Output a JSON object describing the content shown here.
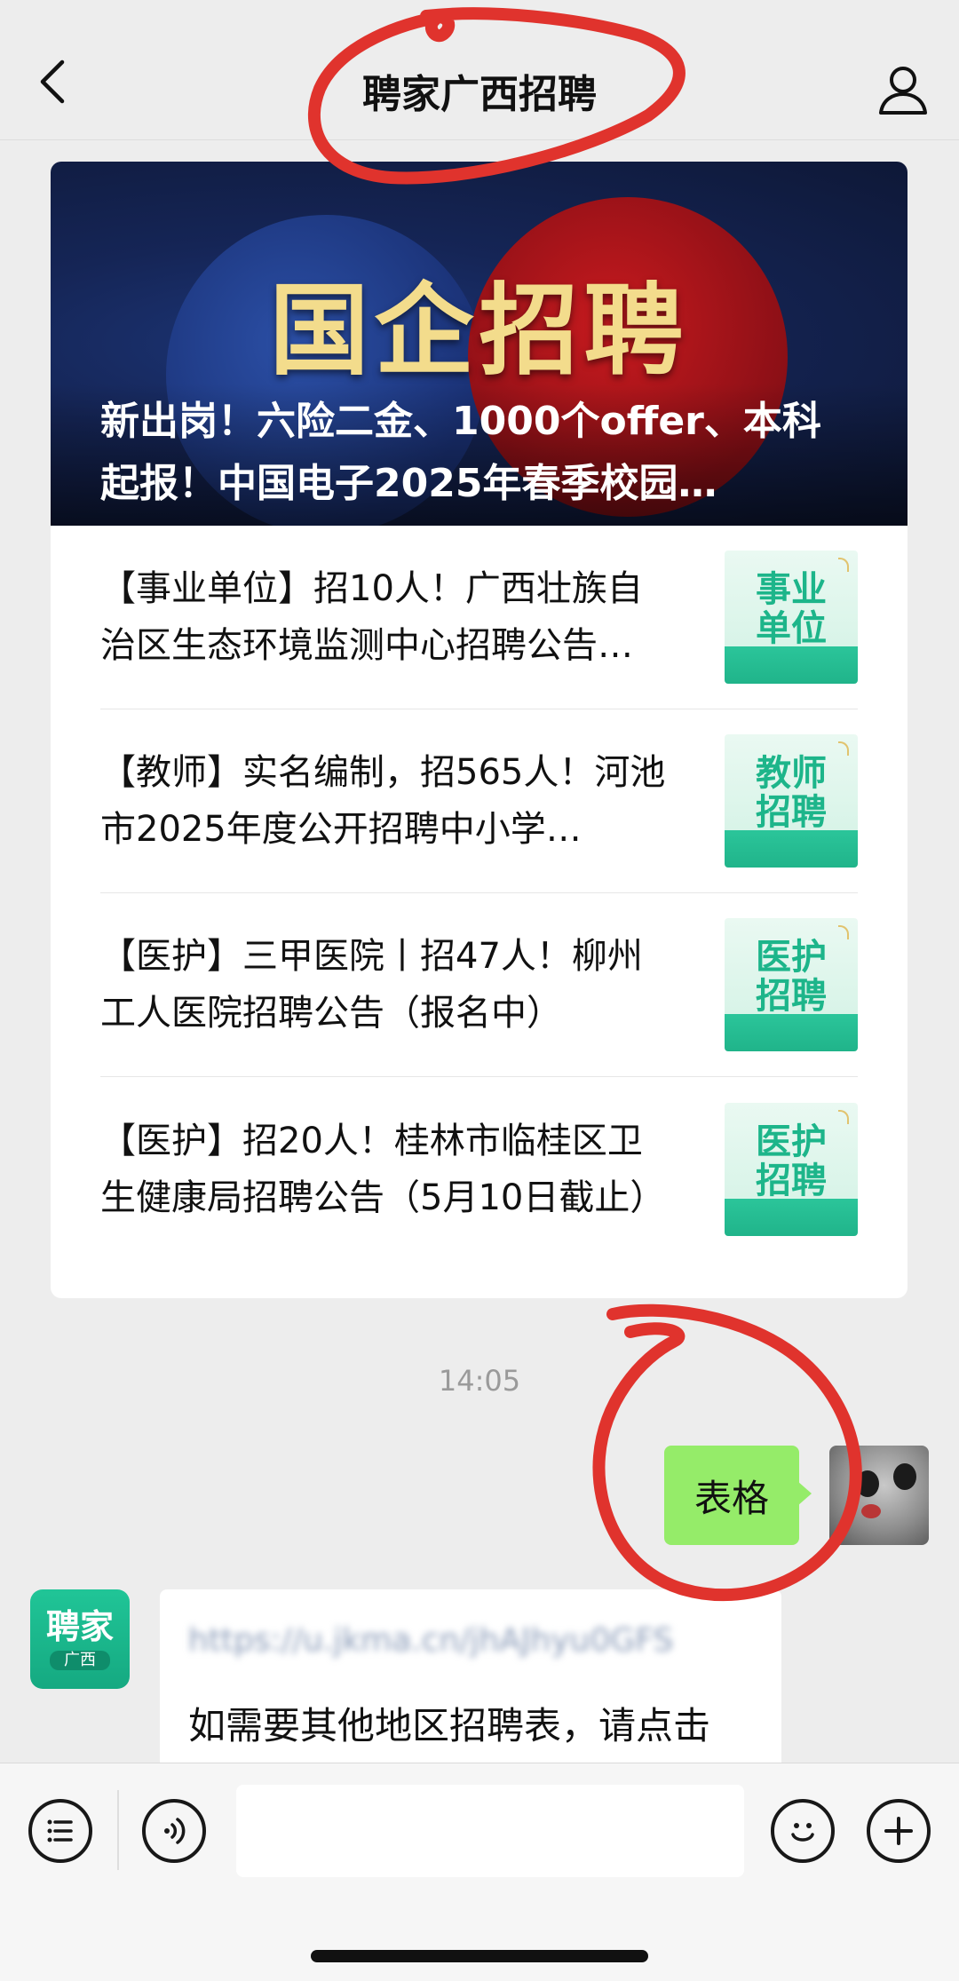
{
  "header": {
    "title": "聘家广西招聘",
    "back_icon": "chevron-left-icon",
    "profile_icon": "person-icon"
  },
  "article_card": {
    "hero": {
      "banner_text": "国企招聘",
      "caption": "新出岗！六险二金、1000个offer、本科起报！中国电子2025年春季校园…"
    },
    "items": [
      {
        "text": "【事业单位】招10人！广西壮族自治区生态环境监测中心招聘公告…",
        "thumb_line1": "事业",
        "thumb_line2": "单位"
      },
      {
        "text": "【教师】实名编制，招565人！河池市2025年度公开招聘中小学…",
        "thumb_line1": "教师",
        "thumb_line2": "招聘"
      },
      {
        "text": "【医护】三甲医院丨招47人！柳州工人医院招聘公告（报名中）",
        "thumb_line1": "医护",
        "thumb_line2": "招聘"
      },
      {
        "text": "【医护】招20人！桂林市临桂区卫生健康局招聘公告（5月10日截止）",
        "thumb_line1": "医护",
        "thumb_line2": "招聘"
      }
    ]
  },
  "chat": {
    "timestamp": "14:05",
    "my_message": "表格",
    "bot_avatar": {
      "name": "聘家",
      "sub": "广西"
    },
    "bot_message": {
      "link_text": "https://u.jkma.cn/jhAJhyu0GFS",
      "text": "如需要其他地区招聘表，请点击"
    }
  },
  "input_bar": {
    "menu_icon": "menu-list-icon",
    "voice_icon": "voice-icon",
    "emoji_icon": "smile-icon",
    "plus_icon": "plus-icon"
  },
  "colors": {
    "background": "#ededed",
    "my_bubble": "#95ec69",
    "brand_green": "#1db58a",
    "annotation_red": "#e0332d",
    "banner_gold": "#f3dc8c"
  }
}
